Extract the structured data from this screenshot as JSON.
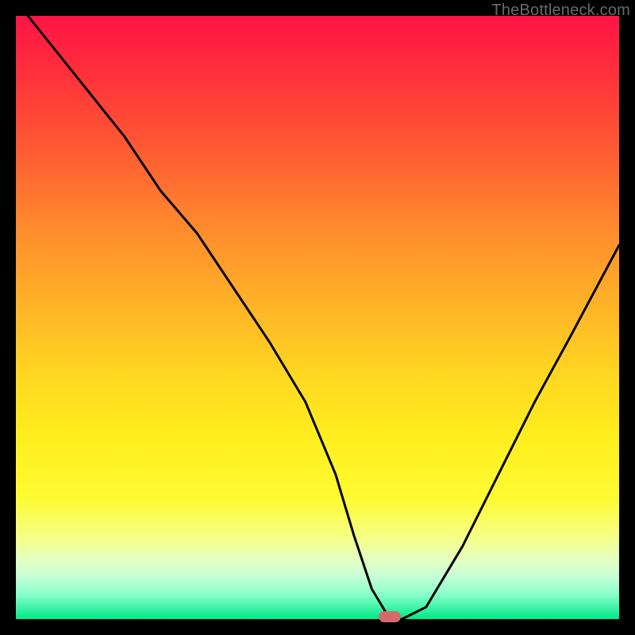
{
  "watermark": "TheBottleneck.com",
  "chart_data": {
    "type": "line",
    "title": "",
    "xlabel": "",
    "ylabel": "",
    "xlim": [
      0,
      100
    ],
    "ylim": [
      0,
      100
    ],
    "grid": false,
    "legend": false,
    "background": "heat-gradient-red-to-green",
    "series": [
      {
        "name": "bottleneck-curve",
        "x": [
          2,
          10,
          18,
          24,
          30,
          36,
          42,
          48,
          53,
          56,
          59,
          62,
          64,
          68,
          74,
          80,
          86,
          92,
          100
        ],
        "y": [
          100,
          90,
          80,
          71,
          64,
          55,
          46,
          36,
          24,
          14,
          5,
          0,
          0,
          2,
          12,
          24,
          36,
          47,
          62
        ]
      }
    ],
    "marker": {
      "x": 62,
      "y": 0,
      "color": "#d46a6a"
    },
    "colors": {
      "curve": "#000000",
      "frame": "#000000",
      "gradient_top": "#ff1445",
      "gradient_bottom": "#00e887"
    }
  }
}
